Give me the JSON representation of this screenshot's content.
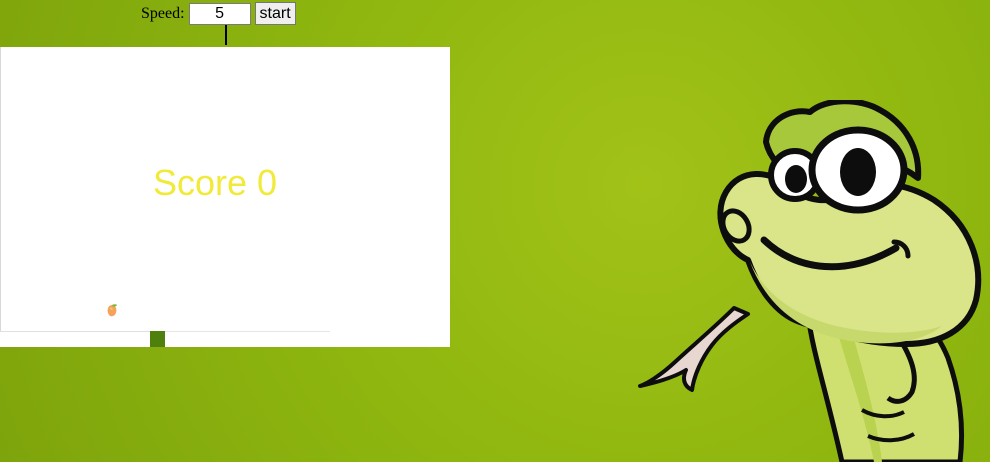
{
  "controls": {
    "speed_label": "Speed:",
    "speed_value": "5",
    "start_label": "start"
  },
  "game": {
    "score_text": "Score 0",
    "food_icon": "mango-icon",
    "mascot": "cartoon-snake-mascot"
  },
  "colors": {
    "background": "#8fb70f",
    "board": "#ffffff",
    "score": "#f2ea3a",
    "snake": "#4f7f0d"
  }
}
